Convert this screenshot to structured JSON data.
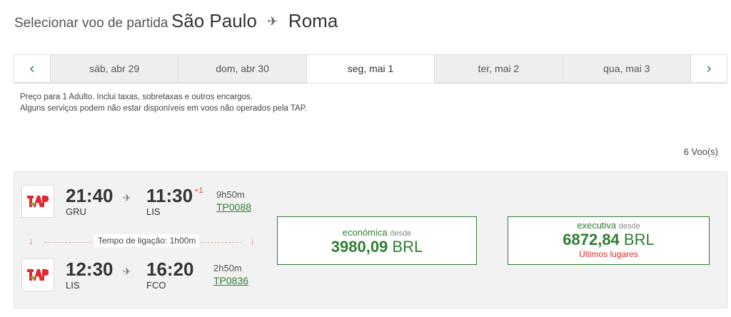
{
  "header": {
    "prefix": "Selecionar voo de partida",
    "origin": "São Paulo",
    "destination": "Roma"
  },
  "dates": {
    "prev_icon": "chevron-left-icon",
    "next_icon": "chevron-right-icon",
    "tabs": [
      {
        "label": "sáb, abr 29",
        "active": false
      },
      {
        "label": "dom, abr 30",
        "active": false
      },
      {
        "label": "seg, mai 1",
        "active": true
      },
      {
        "label": "ter, mai 2",
        "active": false
      },
      {
        "label": "qua, mai 3",
        "active": false
      }
    ]
  },
  "notice": {
    "line1": "Preço para 1 Adulto. Inclui taxas, sobretaxas e outros encargos.",
    "line2": "Alguns serviços podem não estar disponíveis em voos não operados pela TAP."
  },
  "results_count": "6 Voo(s)",
  "itinerary": {
    "segments": [
      {
        "dep_time": "21:40",
        "dep_code": "GRU",
        "arr_time": "11:30",
        "arr_code": "LIS",
        "day_offset": "+1",
        "duration": "9h50m",
        "flight": "TP0088"
      },
      {
        "dep_time": "12:30",
        "dep_code": "LIS",
        "arr_time": "16:20",
        "arr_code": "FCO",
        "day_offset": "",
        "duration": "2h50m",
        "flight": "TP0836"
      }
    ],
    "connection": "Tempo de ligação: 1h00m",
    "fares": {
      "economy": {
        "label": "económica",
        "since": "desde",
        "amount": "3980,09",
        "currency": "BRL"
      },
      "executive": {
        "label": "executiva",
        "since": "desde",
        "amount": "6872,84",
        "currency": "BRL",
        "note": "Últimos lugares"
      }
    }
  },
  "colors": {
    "accent_green": "#2e7d32",
    "alert_red": "#d32f2f",
    "tap_red": "#e3262f",
    "tap_green": "#7cbd2a"
  }
}
